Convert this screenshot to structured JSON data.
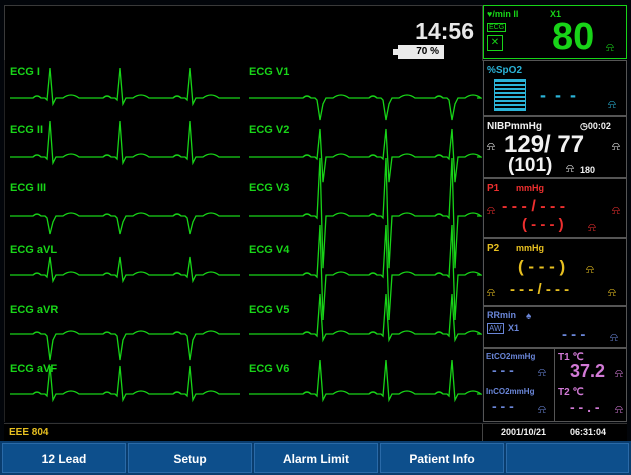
{
  "header": {
    "time": "14:56",
    "battery": "70 %"
  },
  "leads": {
    "left": [
      "ECG I",
      "ECG II",
      "ECG III",
      "ECG aVL",
      "ECG aVR",
      "ECG aVF"
    ],
    "right": [
      "ECG V1",
      "ECG V2",
      "ECG V3",
      "ECG V4",
      "ECG V5",
      "ECG V6"
    ]
  },
  "hr": {
    "unit": "♥/min II",
    "source": "X1",
    "ecg_badge": "ECG",
    "value": "80"
  },
  "spo2": {
    "label": "%SpO2",
    "value": "- - -"
  },
  "nibp": {
    "label": "NIBPmmHg",
    "timer": "00:02",
    "sys_dia": "129/ 77",
    "mean": "(101)",
    "interval": "180"
  },
  "p1": {
    "label": "P1",
    "unit": "mmHg",
    "sys_dia": "- - - / - - -",
    "mean": "( - - - )"
  },
  "p2": {
    "label": "P2",
    "unit": "mmHg",
    "mean": "( - - - )",
    "sys_dia": "- - - / - - -"
  },
  "rr": {
    "label": "RRmin",
    "badge": "AW",
    "source": "X1",
    "value": "- - -"
  },
  "etco2": {
    "label": "EtCO2mmHg",
    "value": "- - -",
    "in_label": "InCO2mmHg",
    "in_value": "- - -"
  },
  "temp": {
    "t1_label": "T1 ℃",
    "t1_value": "37.2",
    "t2_label": "T2 ℃",
    "t2_value": "- - . -"
  },
  "status": {
    "patient_id": "EEE 804",
    "date": "2001/10/21",
    "clock": "06:31:04"
  },
  "softkeys": [
    "12 Lead",
    "Setup",
    "Alarm Limit",
    "Patient Info"
  ],
  "colors": {
    "green": "#18d418",
    "cyan": "#2bb4d8",
    "red": "#ee2f2f",
    "yellow": "#e8c020",
    "blue": "#6a86d8",
    "purple": "#d27ad6"
  }
}
